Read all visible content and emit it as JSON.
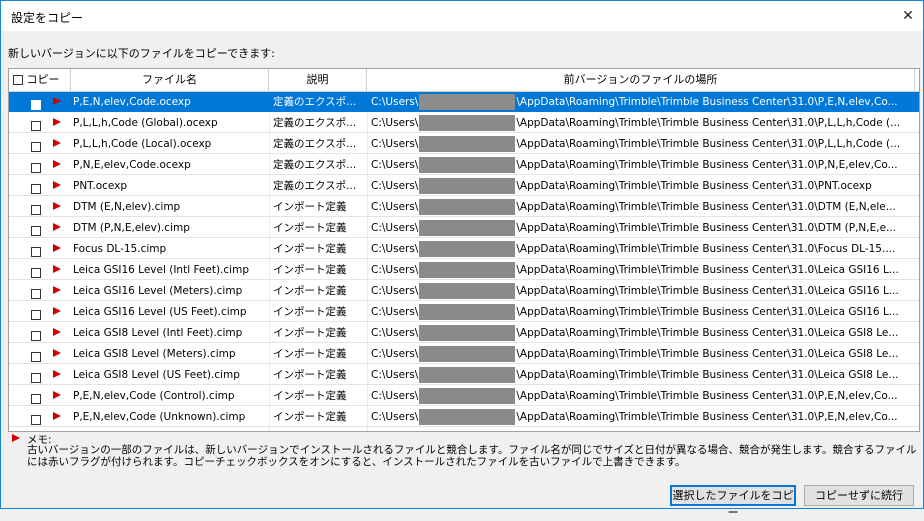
{
  "window": {
    "title": "設定をコピー",
    "close_glyph": "✕"
  },
  "instruction": "新しいバージョンに以下のファイルをコピーできます:",
  "table": {
    "columns": {
      "copy": "コピー",
      "file_name": "ファイル名",
      "description": "説明",
      "location": "前バージョンのファイルの場所"
    },
    "rows": [
      {
        "name": "P,E,N,elev,Code.ocexp",
        "description": "定義のエクスポ...",
        "path_prefix": "C:\\Users\\",
        "path_suffix": "\\AppData\\Roaming\\Trimble\\Trimble Business Center\\31.0\\P,E,N,elev,Co...",
        "selected": true
      },
      {
        "name": "P,L,L,h,Code (Global).ocexp",
        "description": "定義のエクスポ...",
        "path_prefix": "C:\\Users\\",
        "path_suffix": "\\AppData\\Roaming\\Trimble\\Trimble Business Center\\31.0\\P,L,L,h,Code (..."
      },
      {
        "name": "P,L,L,h,Code (Local).ocexp",
        "description": "定義のエクスポ...",
        "path_prefix": "C:\\Users\\",
        "path_suffix": "\\AppData\\Roaming\\Trimble\\Trimble Business Center\\31.0\\P,L,L,h,Code (..."
      },
      {
        "name": "P,N,E,elev,Code.ocexp",
        "description": "定義のエクスポ...",
        "path_prefix": "C:\\Users\\",
        "path_suffix": "\\AppData\\Roaming\\Trimble\\Trimble Business Center\\31.0\\P,N,E,elev,Co..."
      },
      {
        "name": "PNT.ocexp",
        "description": "定義のエクスポ...",
        "path_prefix": "C:\\Users\\",
        "path_suffix": "\\AppData\\Roaming\\Trimble\\Trimble Business Center\\31.0\\PNT.ocexp"
      },
      {
        "name": "DTM (E,N,elev).cimp",
        "description": "インポート定義",
        "path_prefix": "C:\\Users\\",
        "path_suffix": "\\AppData\\Roaming\\Trimble\\Trimble Business Center\\31.0\\DTM (E,N,ele..."
      },
      {
        "name": "DTM (P,N,E,elev).cimp",
        "description": "インポート定義",
        "path_prefix": "C:\\Users\\",
        "path_suffix": "\\AppData\\Roaming\\Trimble\\Trimble Business Center\\31.0\\DTM (P,N,E,e..."
      },
      {
        "name": "Focus DL-15.cimp",
        "description": "インポート定義",
        "path_prefix": "C:\\Users\\",
        "path_suffix": "\\AppData\\Roaming\\Trimble\\Trimble Business Center\\31.0\\Focus DL-15...."
      },
      {
        "name": "Leica GSI16 Level (Intl Feet).cimp",
        "description": "インポート定義",
        "path_prefix": "C:\\Users\\",
        "path_suffix": "\\AppData\\Roaming\\Trimble\\Trimble Business Center\\31.0\\Leica GSI16 L..."
      },
      {
        "name": "Leica GSI16 Level (Meters).cimp",
        "description": "インポート定義",
        "path_prefix": "C:\\Users\\",
        "path_suffix": "\\AppData\\Roaming\\Trimble\\Trimble Business Center\\31.0\\Leica GSI16 L..."
      },
      {
        "name": "Leica GSI16 Level (US Feet).cimp",
        "description": "インポート定義",
        "path_prefix": "C:\\Users\\",
        "path_suffix": "\\AppData\\Roaming\\Trimble\\Trimble Business Center\\31.0\\Leica GSI16 L..."
      },
      {
        "name": "Leica GSI8 Level (Intl Feet).cimp",
        "description": "インポート定義",
        "path_prefix": "C:\\Users\\",
        "path_suffix": "\\AppData\\Roaming\\Trimble\\Trimble Business Center\\31.0\\Leica GSI8 Le..."
      },
      {
        "name": "Leica GSI8 Level (Meters).cimp",
        "description": "インポート定義",
        "path_prefix": "C:\\Users\\",
        "path_suffix": "\\AppData\\Roaming\\Trimble\\Trimble Business Center\\31.0\\Leica GSI8 Le..."
      },
      {
        "name": "Leica GSI8 Level (US Feet).cimp",
        "description": "インポート定義",
        "path_prefix": "C:\\Users\\",
        "path_suffix": "\\AppData\\Roaming\\Trimble\\Trimble Business Center\\31.0\\Leica GSI8 Le..."
      },
      {
        "name": "P,E,N,elev,Code (Control).cimp",
        "description": "インポート定義",
        "path_prefix": "C:\\Users\\",
        "path_suffix": "\\AppData\\Roaming\\Trimble\\Trimble Business Center\\31.0\\P,E,N,elev,Co..."
      },
      {
        "name": "P,E,N,elev,Code (Unknown).cimp",
        "description": "インポート定義",
        "path_prefix": "C:\\Users\\",
        "path_suffix": "\\AppData\\Roaming\\Trimble\\Trimble Business Center\\31.0\\P,E,N,elev,Co..."
      }
    ]
  },
  "note": {
    "label": "メモ:",
    "text": "古いバージョンの一部のファイルは、新しいバージョンでインストールされるファイルと競合します。ファイル名が同じでサイズと日付が異なる場合、競合が発生します。競合するファイルには赤いフラグが付けられます。コピーチェックボックスをオンにすると、インストールされたファイルを古いファイルで上書きできます。"
  },
  "buttons": {
    "copy_selected": "選択したファイルをコピー",
    "continue_without_copy": "コピーせずに続行"
  },
  "colors": {
    "selection": "#0078d7",
    "conflict_flag": "#d00000",
    "redaction": "#8a8a8a"
  },
  "icons": {
    "flag": "conflict-flag-icon",
    "close": "close-icon"
  }
}
